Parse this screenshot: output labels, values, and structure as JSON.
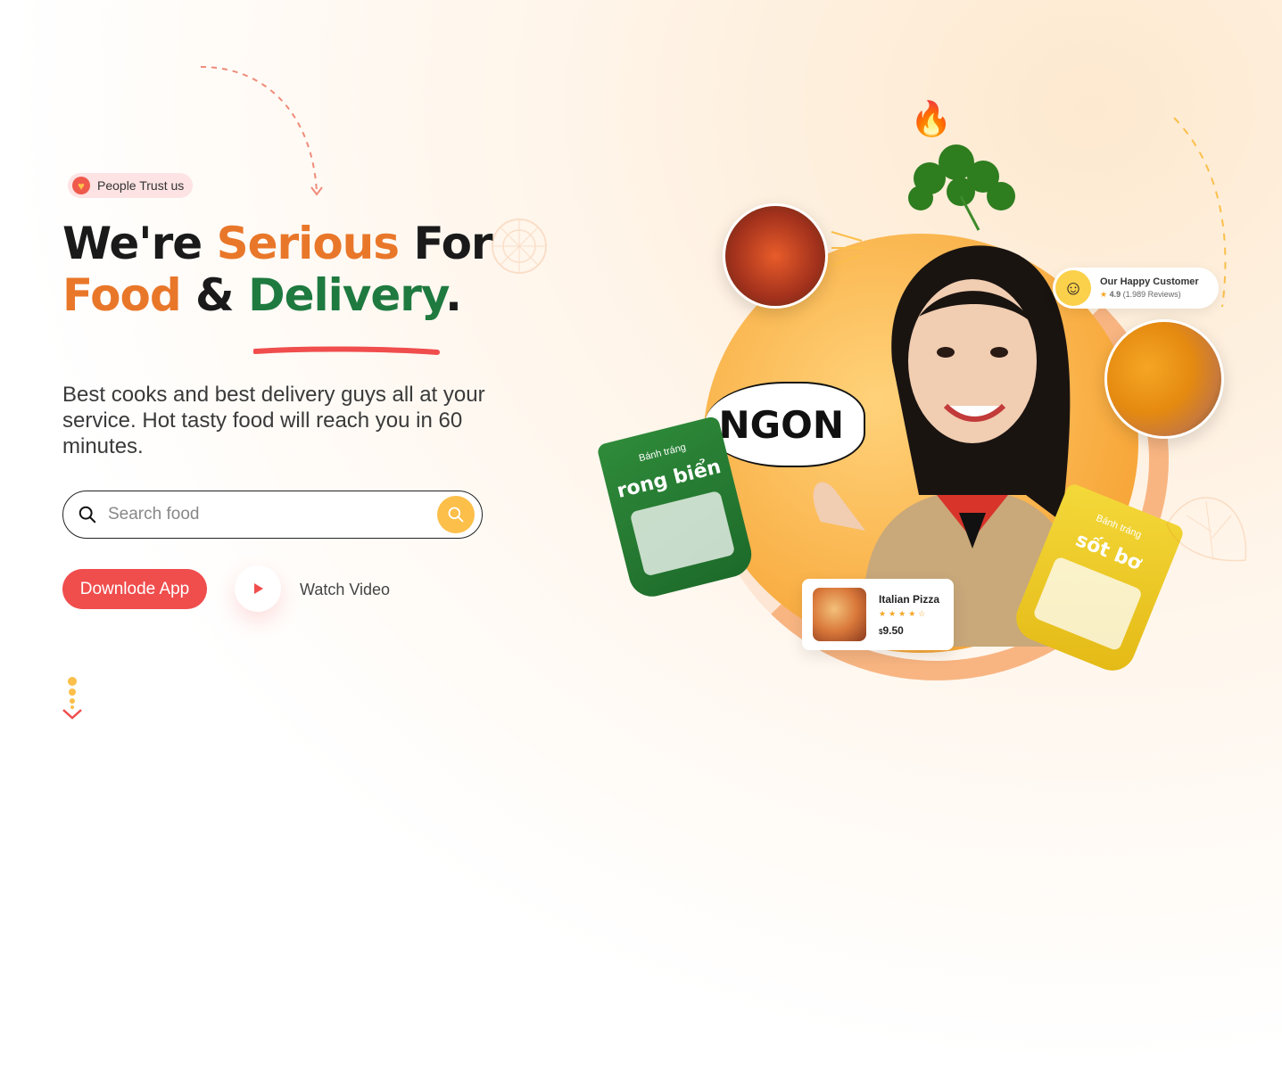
{
  "hero": {
    "badge_text": "People Trust us",
    "headline": {
      "w1": "We're",
      "w2": "Serious",
      "w3": "For",
      "w4": "Food",
      "w5": "&",
      "w6": "Delivery",
      "w7": "."
    },
    "lead": "Best cooks and best delivery guys all at your service. Hot tasty food will reach you in 60 minutes."
  },
  "search": {
    "placeholder": "Search food"
  },
  "actions": {
    "download_label": "Downlode App",
    "watch_label": "Watch Video"
  },
  "customer_card": {
    "title": "Our Happy Customer",
    "rating": "4.9",
    "reviews": "(1.989 Reviews)"
  },
  "pizza_card": {
    "name": "Italian Pizza",
    "stars": "★★★★☆",
    "currency": "$",
    "price": "9.50"
  },
  "sticker": {
    "ngon": "NGON"
  },
  "packs": {
    "left_brand": "Bánh tráng",
    "left_name": "rong biển",
    "right_brand": "Bánh tráng",
    "right_name": "sốt bơ"
  },
  "colors": {
    "accent_red": "#f04d4d",
    "accent_orange": "#e9772a",
    "accent_green": "#1f7a40",
    "accent_yellow": "#fbbf4a"
  },
  "icons": {
    "badge": "heart-icon",
    "search": "search-icon",
    "search_button": "search-icon",
    "play": "play-icon",
    "scroll": "chevron-down-icon",
    "flame": "flame-icon"
  }
}
